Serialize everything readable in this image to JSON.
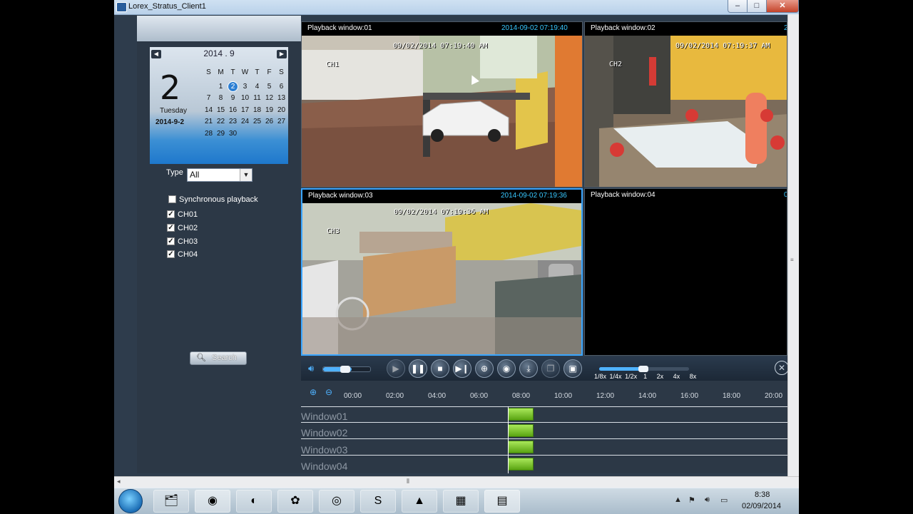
{
  "window": {
    "title": "Lorex_Stratus_Client1",
    "min": "–",
    "max": "□",
    "close": "✕"
  },
  "calendar": {
    "month_label": "2014 . 9",
    "prev": "◀",
    "next": "▶",
    "big_day": "2",
    "weekday": "Tuesday",
    "date": "2014-9-2",
    "weekday_headers": [
      "S",
      "M",
      "T",
      "W",
      "T",
      "F",
      "S"
    ],
    "weeks": [
      [
        "",
        "1",
        "2",
        "3",
        "4",
        "5",
        "6"
      ],
      [
        "7",
        "8",
        "9",
        "10",
        "11",
        "12",
        "13"
      ],
      [
        "14",
        "15",
        "16",
        "17",
        "18",
        "19",
        "20"
      ],
      [
        "21",
        "22",
        "23",
        "24",
        "25",
        "26",
        "27"
      ],
      [
        "28",
        "29",
        "30",
        "",
        "",
        "",
        ""
      ]
    ],
    "selected": "2"
  },
  "filters": {
    "type_label": "Type",
    "type_value": "All",
    "sync_label": "Synchronous playback",
    "channels": [
      {
        "label": "CH01",
        "checked": true
      },
      {
        "label": "CH02",
        "checked": true
      },
      {
        "label": "CH03",
        "checked": true
      },
      {
        "label": "CH04",
        "checked": true
      }
    ],
    "search_label": "Search"
  },
  "playback_windows": [
    {
      "title": "Playback window:01",
      "time": "2014-09-02 07:19:40",
      "osd_time": "09/02/2014 07:19:40 AM",
      "channel": "CH1"
    },
    {
      "title": "Playback window:02",
      "time": "2",
      "osd_time": "09/02/2014 07:19:37 AM",
      "channel": "CH2"
    },
    {
      "title": "Playback window:03",
      "time": "2014-09-02 07:19:36",
      "osd_time": "09/02/2014 07:19:36 AM",
      "channel": "CH3"
    },
    {
      "title": "Playback window:04",
      "time": "0",
      "osd_time": "",
      "channel": ""
    }
  ],
  "speeds": [
    "1/8x",
    "1/4x",
    "1/2x",
    "1",
    "2x",
    "4x",
    "8x"
  ],
  "timeline": {
    "ticks": [
      "00:00",
      "02:00",
      "04:00",
      "06:00",
      "08:00",
      "10:00",
      "12:00",
      "14:00",
      "16:00",
      "18:00",
      "20:00"
    ],
    "rows": [
      "Window01",
      "Window02",
      "Window03",
      "Window04"
    ]
  },
  "taskbar": {
    "time": "8:38",
    "date": "02/09/2014"
  }
}
